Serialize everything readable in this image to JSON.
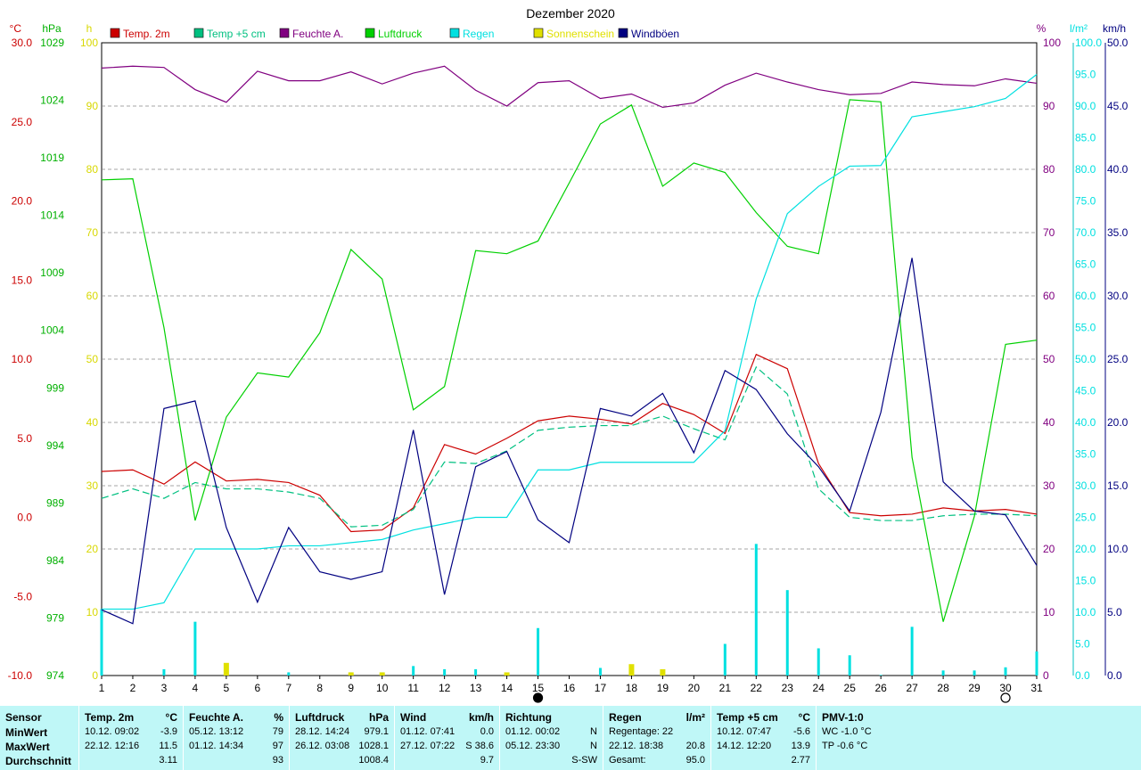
{
  "chart_data": {
    "type": "line",
    "title": "Dezember 2020",
    "axes": {
      "left_temp": {
        "unit": "°C",
        "min": -10,
        "max": 30,
        "ticks": [
          "-10.0",
          "-5.0",
          "0.0",
          "5.0",
          "10.0",
          "15.0",
          "20.0",
          "25.0",
          "30.0"
        ],
        "color": "#cc0000"
      },
      "left_pressure": {
        "unit": "hPa",
        "min": 974,
        "max": 1034,
        "ticks": [
          "974",
          "979",
          "984",
          "989",
          "994",
          "999",
          "1004",
          "1009",
          "1014",
          "1019",
          "1024",
          "1029"
        ],
        "color": "#00b000"
      },
      "left_sun": {
        "unit": "h",
        "min": 0,
        "max": 100,
        "ticks": [
          "0",
          "10",
          "20",
          "30",
          "40",
          "50",
          "60",
          "70",
          "80",
          "90",
          "100"
        ],
        "color": "#d8d800"
      },
      "right_humidity": {
        "unit": "%",
        "min": 0,
        "max": 100,
        "ticks": [
          "0",
          "10",
          "20",
          "30",
          "40",
          "50",
          "60",
          "70",
          "80",
          "90",
          "100"
        ],
        "color": "#800080"
      },
      "right_rain": {
        "unit": "l/m²",
        "min": 0,
        "max": 100,
        "ticks": [
          "0.0",
          "5.0",
          "10.0",
          "15.0",
          "20.0",
          "25.0",
          "30.0",
          "35.0",
          "40.0",
          "45.0",
          "50.0",
          "55.0",
          "60.0",
          "65.0",
          "70.0",
          "75.0",
          "80.0",
          "85.0",
          "90.0",
          "95.0",
          "100.0"
        ],
        "color": "#00e0e0"
      },
      "right_wind": {
        "unit": "km/h",
        "min": 0,
        "max": 50,
        "ticks": [
          "0.0",
          "5.0",
          "10.0",
          "15.0",
          "20.0",
          "25.0",
          "30.0",
          "35.0",
          "40.0",
          "45.0",
          "50.0"
        ],
        "color": "#000080"
      }
    },
    "x": [
      1,
      2,
      3,
      4,
      5,
      6,
      7,
      8,
      9,
      10,
      11,
      12,
      13,
      14,
      15,
      16,
      17,
      18,
      19,
      20,
      21,
      22,
      23,
      24,
      25,
      26,
      27,
      28,
      29,
      30,
      31
    ],
    "x_ticks": [
      "1",
      "2",
      "3",
      "4",
      "5",
      "6",
      "7",
      "8",
      "9",
      "10",
      "11",
      "12",
      "13",
      "14",
      "15",
      "16",
      "17",
      "18",
      "19",
      "20",
      "21",
      "22",
      "23",
      "24",
      "25",
      "26",
      "27",
      "28",
      "29",
      "30",
      "31"
    ],
    "legend": [
      {
        "label": "Temp. 2m",
        "color": "#cc0000"
      },
      {
        "label": "Temp +5 cm",
        "color": "#00c080"
      },
      {
        "label": "Feuchte A.",
        "color": "#800080"
      },
      {
        "label": "Luftdruck",
        "color": "#00d000"
      },
      {
        "label": "Regen",
        "color": "#00e0e0"
      },
      {
        "label": "Sonnenschein",
        "color": "#e0e000"
      },
      {
        "label": "Windböen",
        "color": "#000080"
      }
    ],
    "series": [
      {
        "name": "Temp. 2m",
        "axis": "left_temp",
        "color": "#cc0000",
        "values": [
          2.9,
          3.0,
          2.1,
          3.5,
          2.3,
          2.4,
          2.2,
          1.4,
          -0.9,
          -0.8,
          0.6,
          4.6,
          4.0,
          5.0,
          6.1,
          6.4,
          6.2,
          5.9,
          7.2,
          6.5,
          5.3,
          10.3,
          9.4,
          3.4,
          0.3,
          0.1,
          0.2,
          0.6,
          0.4,
          0.5,
          0.2
        ]
      },
      {
        "name": "Temp +5 cm",
        "axis": "left_temp",
        "color": "#00c080",
        "dashed": true,
        "values": [
          1.2,
          1.8,
          1.2,
          2.2,
          1.8,
          1.8,
          1.6,
          1.2,
          -0.6,
          -0.5,
          0.5,
          3.5,
          3.4,
          4.2,
          5.5,
          5.7,
          5.8,
          5.8,
          6.4,
          5.6,
          4.9,
          9.5,
          7.8,
          1.8,
          0.0,
          -0.2,
          -0.2,
          0.1,
          0.2,
          0.2,
          0.1
        ]
      },
      {
        "name": "Feuchte A.",
        "axis": "right_humidity",
        "color": "#800080",
        "values": [
          96,
          96.3,
          96.1,
          92.6,
          90.6,
          95.5,
          94,
          94,
          95.4,
          93.5,
          95.2,
          96.3,
          92.5,
          90,
          93.7,
          94,
          91.2,
          91.9,
          89.8,
          90.5,
          93.3,
          95.2,
          93.8,
          92.6,
          91.8,
          92,
          93.8,
          93.4,
          93.2,
          94.3,
          93.6
        ]
      },
      {
        "name": "Luftdruck",
        "axis": "left_pressure",
        "color": "#00d000",
        "values": [
          1021.0,
          1021.1,
          1007.0,
          988.7,
          998.5,
          1002.7,
          1002.3,
          1006.5,
          1014.4,
          1011.6,
          999.2,
          1001.4,
          1014.3,
          1014.0,
          1015.2,
          1020.7,
          1026.3,
          1028.1,
          1020.4,
          1022.6,
          1021.7,
          1017.9,
          1014.7,
          1014.0,
          1028.6,
          1028.4,
          994.7,
          979.1,
          989.1,
          1005.4,
          1005.8
        ]
      },
      {
        "name": "Regen",
        "axis": "right_rain",
        "color": "#00e0e0",
        "values": [
          10.5,
          10.5,
          11.5,
          20.0,
          20.0,
          20.0,
          20.5,
          20.5,
          21.0,
          21.5,
          23.0,
          24.0,
          25.0,
          25.0,
          32.5,
          32.5,
          33.7,
          33.7,
          33.7,
          33.7,
          38.7,
          59.5,
          73.0,
          77.3,
          80.5,
          80.6,
          88.3,
          89.1,
          89.9,
          91.2,
          95.0
        ]
      },
      {
        "name": "Regen Tag",
        "axis": "right_rain",
        "color": "#00e0e0",
        "bars": true,
        "values": [
          10.5,
          0.0,
          1.0,
          8.5,
          0.0,
          0.0,
          0.5,
          0.0,
          0.5,
          0.5,
          1.5,
          1.0,
          1.0,
          0.0,
          7.5,
          0.0,
          1.2,
          0.0,
          0.0,
          0.0,
          5.0,
          20.8,
          13.5,
          4.3,
          3.2,
          0.1,
          7.7,
          0.8,
          0.8,
          1.3,
          3.8
        ]
      },
      {
        "name": "Sonnenschein",
        "axis": "left_sun",
        "color": "#e0e000",
        "bars": true,
        "values": [
          0,
          0,
          0,
          0,
          2.0,
          0,
          0,
          0,
          0.5,
          0.5,
          0,
          0,
          0,
          0.5,
          0,
          0,
          0,
          1.8,
          1.0,
          0,
          0,
          0,
          0,
          0,
          0,
          0,
          0,
          0,
          0,
          0,
          0
        ]
      },
      {
        "name": "Windböen",
        "axis": "right_wind",
        "color": "#000080",
        "values": [
          5.2,
          4.1,
          21.1,
          21.7,
          11.7,
          5.8,
          11.7,
          8.2,
          7.6,
          8.2,
          19.4,
          6.4,
          16.5,
          17.7,
          12.3,
          10.5,
          21.1,
          20.5,
          22.3,
          17.6,
          24.1,
          22.6,
          19.1,
          16.5,
          13.0,
          20.8,
          33.0,
          15.3,
          13.0,
          12.7,
          8.7
        ]
      }
    ],
    "moon_symbols": [
      {
        "day": 15,
        "phase": "new"
      },
      {
        "day": 30,
        "phase": "full"
      }
    ],
    "grid": true
  },
  "stats": {
    "sensor": {
      "header": "Sensor",
      "rows": [
        "MinWert",
        "MaxWert",
        "Durchschnitt"
      ]
    },
    "temp2m": {
      "header": "Temp. 2m",
      "unit": "°C",
      "min_time": "10.12.  09:02",
      "min_val": "-3.9",
      "max_time": "22.12.  12:16",
      "max_val": "11.5",
      "avg": "3.11"
    },
    "feuchte": {
      "header": "Feuchte A.",
      "unit": "%",
      "min_time": "05.12.  13:12",
      "min_val": "79",
      "max_time": "01.12.  14:34",
      "max_val": "97",
      "avg": "93"
    },
    "luftdruck": {
      "header": "Luftdruck",
      "unit": "hPa",
      "min_time": "28.12.  14:24",
      "min_val": "979.1",
      "max_time": "26.12.  03:08",
      "max_val": "1028.1",
      "avg": "1008.4"
    },
    "wind": {
      "header": "Wind",
      "unit": "km/h",
      "min_time": "01.12.  07:41",
      "min_val": "0.0",
      "max_time": "27.12.  07:22",
      "max_val": "S 38.6",
      "avg": "9.7"
    },
    "richtung": {
      "header": "Richtung",
      "min_time": "01.12.  00:02",
      "min_val": "N",
      "max_time": "05.12.  23:30",
      "max_val": "N",
      "avg": "S-SW"
    },
    "regen": {
      "header": "Regen",
      "unit": "l/m²",
      "row1": "Regentage: 22",
      "row2": "22.12.  18:38",
      "row2_val": "20.8",
      "row3": "Gesamt:",
      "row3_val": "95.0"
    },
    "temp5": {
      "header": "Temp +5 cm",
      "unit": "°C",
      "min_time": "10.12.  07:47",
      "min_val": "-5.6",
      "max_time": "14.12.  12:20",
      "max_val": "13.9",
      "avg": "2.77"
    },
    "pmv": {
      "header": "PMV-1:0",
      "wc": "WC -1.0 °C",
      "tp": "TP -0.6 °C"
    }
  }
}
